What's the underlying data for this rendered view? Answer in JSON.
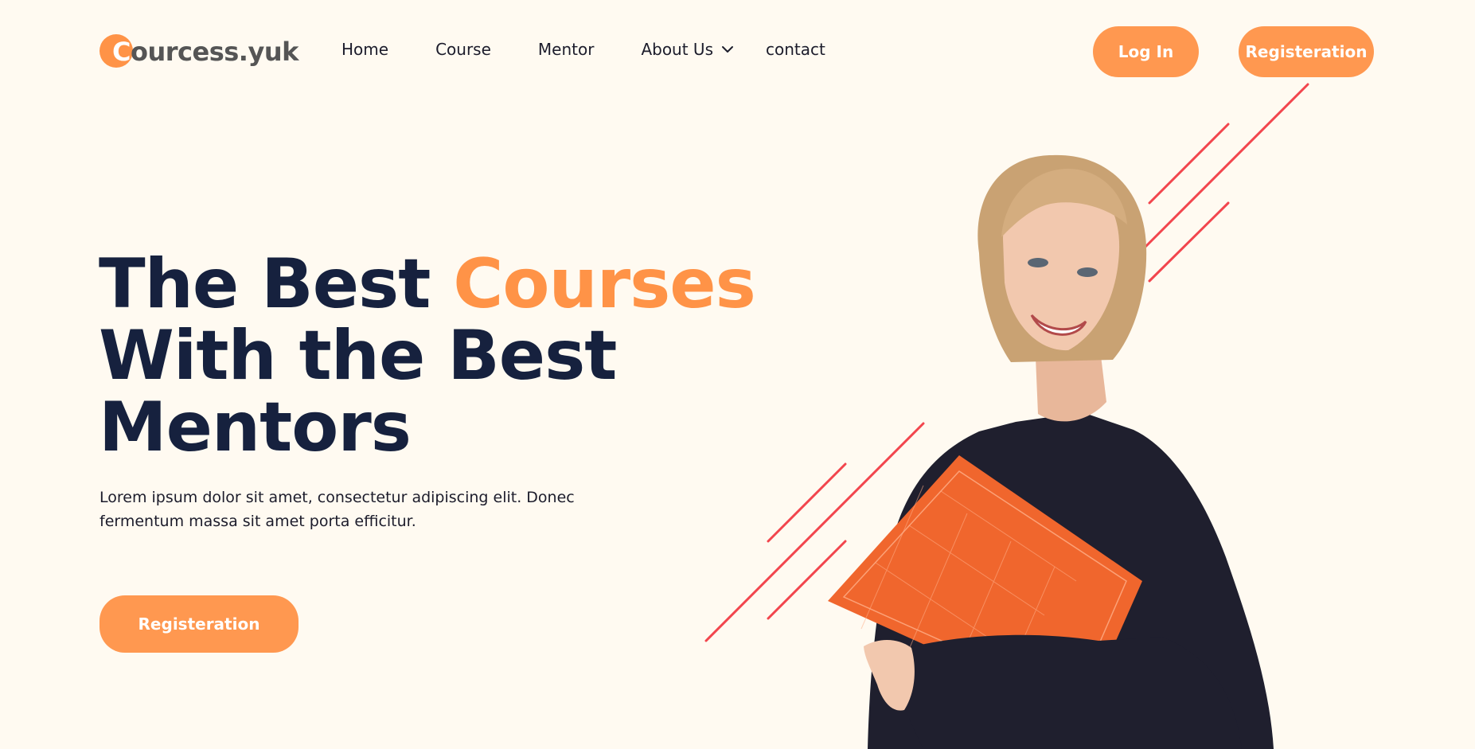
{
  "header": {
    "logo_initial": "C",
    "logo_rest": "ourcess.yuk",
    "nav": {
      "home": "Home",
      "course": "Course",
      "mentor": "Mentor",
      "about": "About Us",
      "contact": "contact"
    },
    "login_label": "Log In",
    "register_label": "Registeration"
  },
  "hero": {
    "title_part1": "The Best ",
    "title_accent": "Courses",
    "title_line2": "With the Best",
    "title_line3": "Mentors",
    "description": "Lorem ipsum dolor sit amet, consectetur adipiscing elit. Donec fermentum massa sit amet porta efficitur.",
    "cta_label": "Registeration"
  },
  "icons": {
    "about_dropdown": "chevron-down-icon"
  },
  "colors": {
    "background": "#fffaf1",
    "accent": "#ff9347",
    "heading": "#16213e",
    "decor_lines": "#f2454d",
    "book": "#f0662d",
    "sweater": "#1f1f2e"
  }
}
